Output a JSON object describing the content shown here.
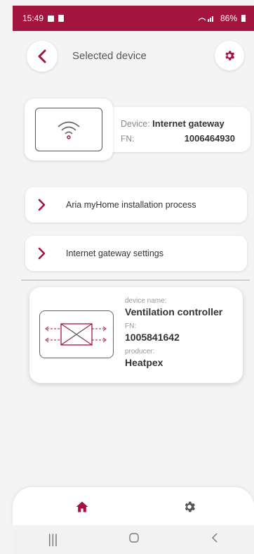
{
  "status_bar": {
    "time": "15:49",
    "battery": "86%"
  },
  "header": {
    "title": "Selected device",
    "back_icon": "chevron-left-icon",
    "settings_icon": "gear-icon"
  },
  "device": {
    "label": "Device:",
    "name": "Internet gateway",
    "fn_label": "FN:",
    "fn_value": "1006464930",
    "icon": "wifi-icon"
  },
  "menu": [
    {
      "label": "Aria myHome installation process"
    },
    {
      "label": "Internet gateway settings"
    }
  ],
  "connected_device": {
    "name_label": "device name:",
    "name": "Ventilation controller",
    "fn_label": "FN:",
    "fn_value": "1005841642",
    "producer_label": "producer:",
    "producer": "Heatpex",
    "icon": "heat-exchanger-icon"
  },
  "bottom_nav": {
    "home_icon": "home-icon",
    "settings_icon": "gear-icon"
  },
  "colors": {
    "accent": "#a3153f",
    "background": "#f4f4f4"
  }
}
